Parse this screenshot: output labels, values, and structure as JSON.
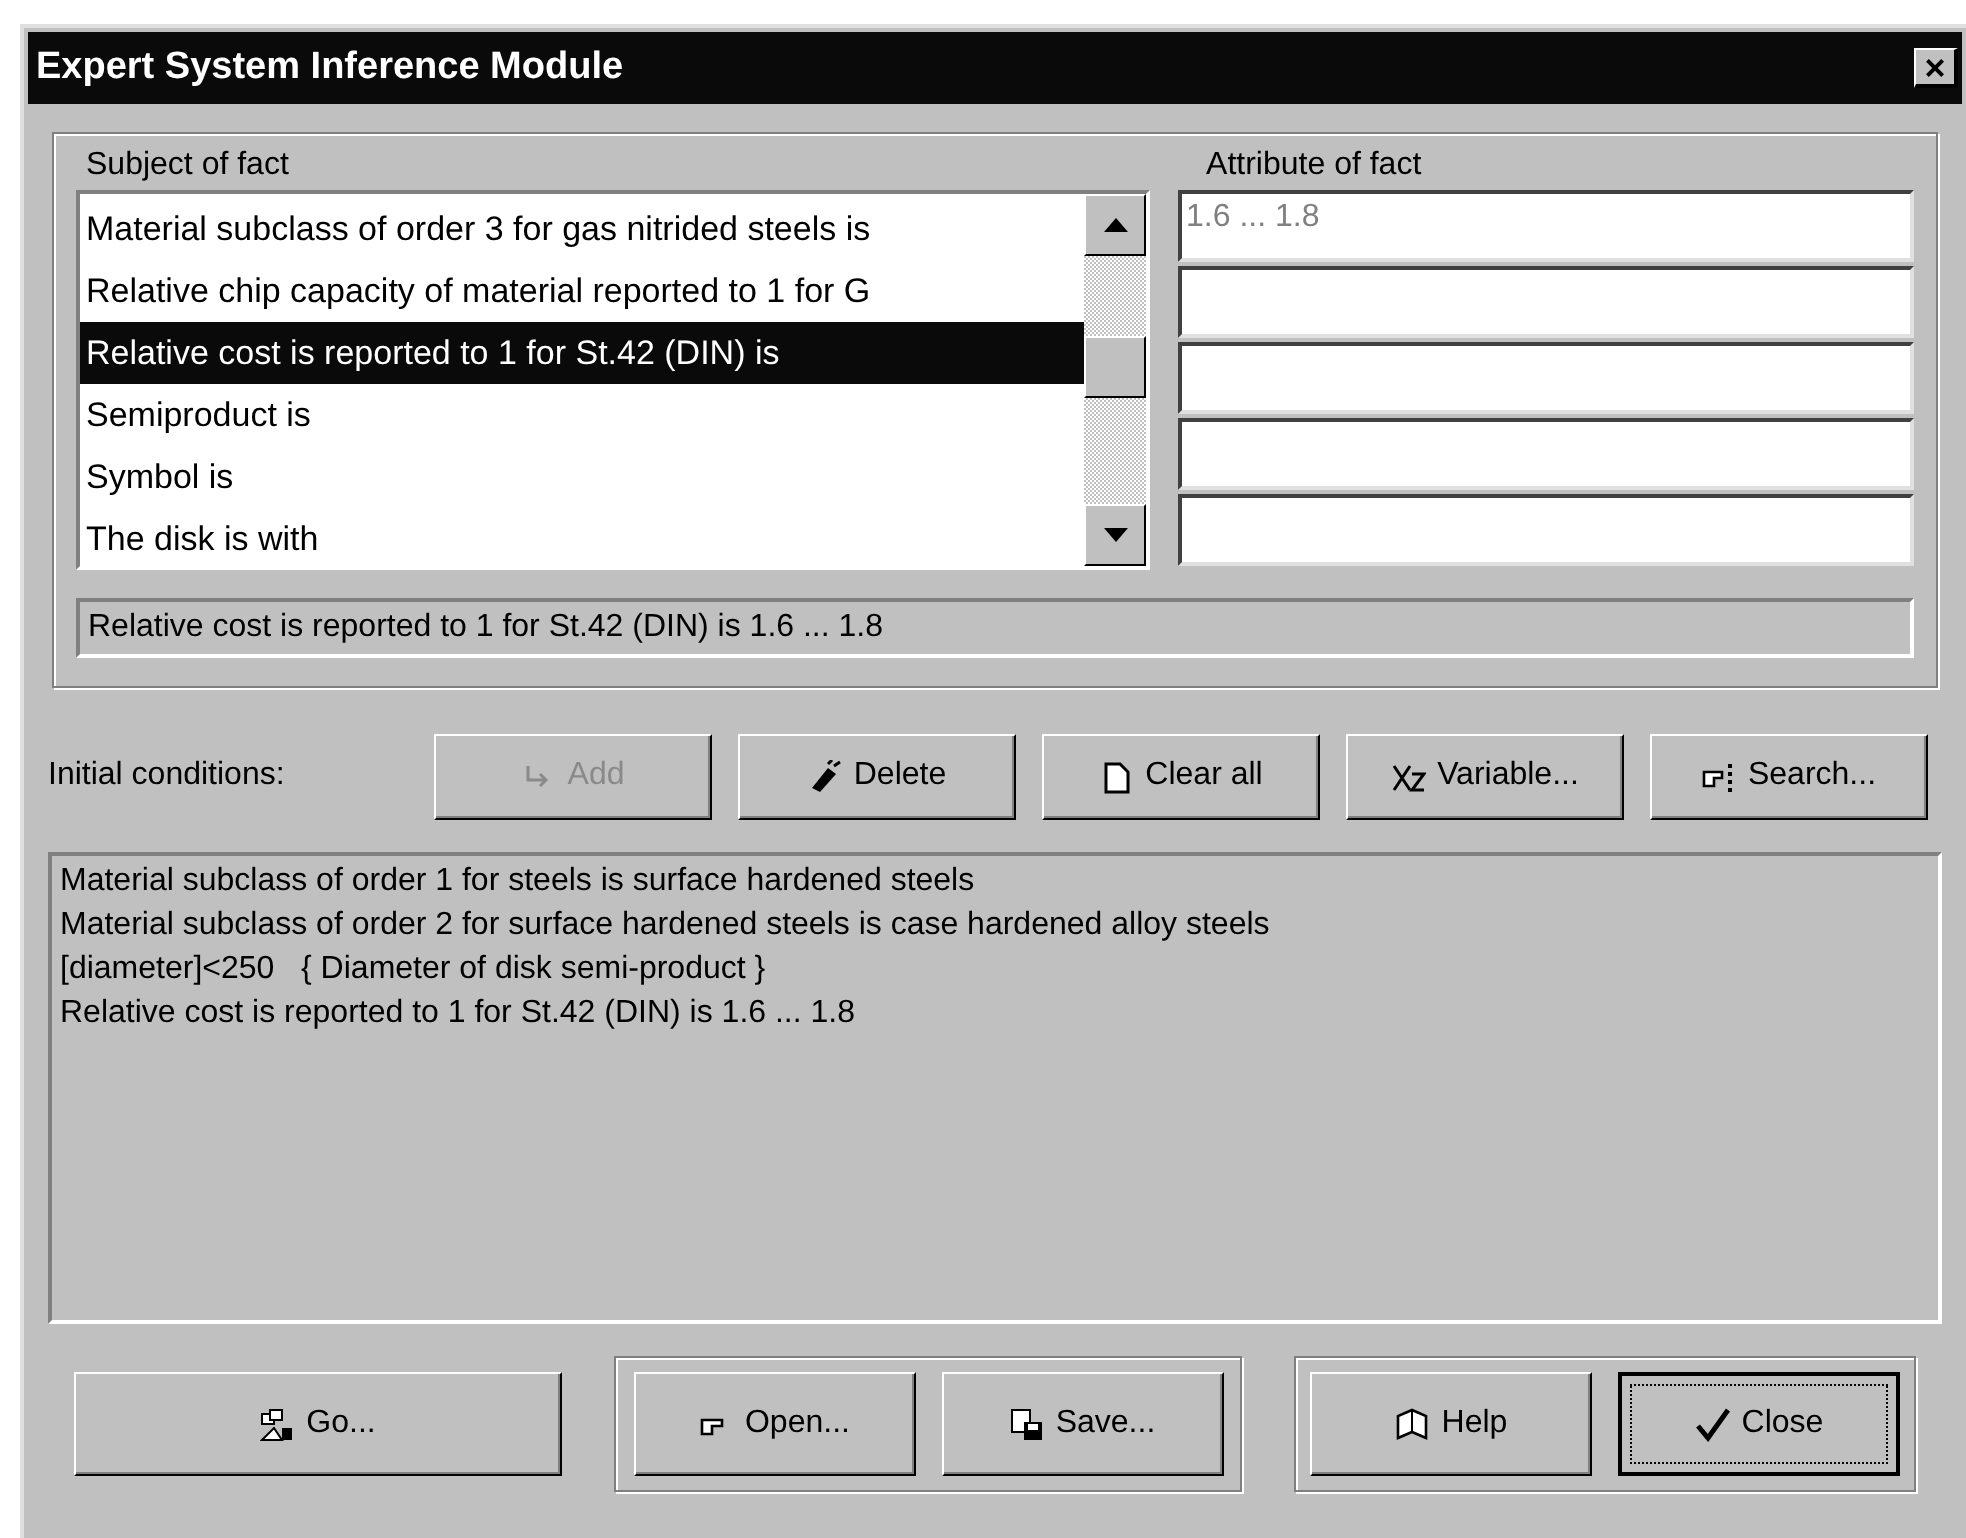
{
  "window": {
    "title": "Expert System Inference Module",
    "close": "×"
  },
  "subject_label": "Subject of fact",
  "attribute_label": "Attribute of fact",
  "subjects": [
    {
      "text": "Material subclass of order 3 for gas nitrided steels is",
      "selected": false
    },
    {
      "text": "Relative chip capacity of material reported to 1 for G",
      "selected": false
    },
    {
      "text": "Relative cost is reported to 1 for St.42 (DIN) is",
      "selected": true
    },
    {
      "text": "Semiproduct is",
      "selected": false
    },
    {
      "text": "Symbol is",
      "selected": false
    },
    {
      "text": "The disk is with",
      "selected": false
    }
  ],
  "attribute_value": "1.6 ... 1.8",
  "fact_preview": "Relative cost is reported to 1 for St.42 (DIN) is 1.6 ... 1.8",
  "conditions_label": "Initial conditions:",
  "condition_buttons": [
    {
      "label": "Add",
      "disabled": true
    },
    {
      "label": "Delete",
      "disabled": false
    },
    {
      "label": "Clear all",
      "disabled": false
    },
    {
      "label": "Variable...",
      "disabled": false
    },
    {
      "label": "Search...",
      "disabled": false
    }
  ],
  "conditions": [
    "Material subclass of order 1 for steels is surface hardened steels",
    "Material subclass of order 2 for surface hardened steels is case hardened alloy steels",
    "[diameter]<250   { Diameter of disk semi-product }",
    "Relative cost is reported to 1 for St.42 (DIN) is 1.6 ... 1.8"
  ],
  "bottom_buttons": [
    {
      "label": "Go...",
      "default": false
    },
    {
      "label": "Open...",
      "default": false
    },
    {
      "label": "Save...",
      "default": false
    },
    {
      "label": "Help",
      "default": false
    },
    {
      "label": "Close",
      "default": true
    }
  ]
}
